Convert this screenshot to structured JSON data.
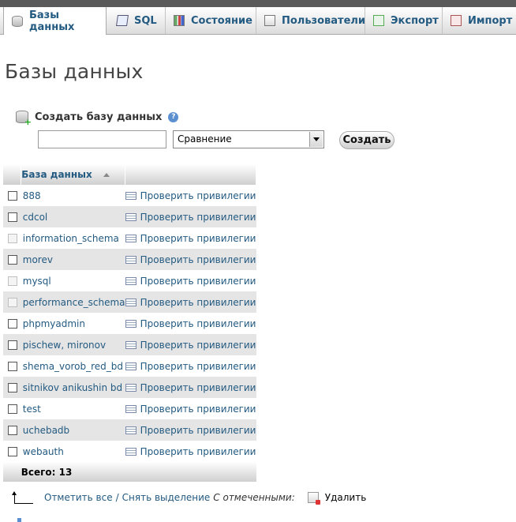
{
  "tabs": [
    {
      "label": "Базы данных",
      "icon": "database-icon",
      "active": true
    },
    {
      "label": "SQL",
      "icon": "sql-icon"
    },
    {
      "label": "Состояние",
      "icon": "status-icon"
    },
    {
      "label": "Пользователи",
      "icon": "users-icon"
    },
    {
      "label": "Экспорт",
      "icon": "export-icon"
    },
    {
      "label": "Импорт",
      "icon": "import-icon"
    }
  ],
  "page_title": "Базы данных",
  "create": {
    "label": "Создать базу данных",
    "collation": "Сравнение",
    "button": "Создать"
  },
  "table": {
    "header": "База данных",
    "rows": [
      {
        "name": "888",
        "action": "Проверить привилегии",
        "system": false
      },
      {
        "name": "cdcol",
        "action": "Проверить привилегии",
        "system": false
      },
      {
        "name": "information_schema",
        "action": "Проверить привилегии",
        "system": true
      },
      {
        "name": "morev",
        "action": "Проверить привилегии",
        "system": false
      },
      {
        "name": "mysql",
        "action": "Проверить привилегии",
        "system": true
      },
      {
        "name": "performance_schema",
        "action": "Проверить привилегии",
        "system": true
      },
      {
        "name": "phpmyadmin",
        "action": "Проверить привилегии",
        "system": false
      },
      {
        "name": "pischew, mironov",
        "action": "Проверить привилегии",
        "system": false
      },
      {
        "name": "shema_vorob_red_bd",
        "action": "Проверить привилегии",
        "system": false
      },
      {
        "name": "sitnikov anikushin bd",
        "action": "Проверить привилегии",
        "system": false
      },
      {
        "name": "test",
        "action": "Проверить привилегии",
        "system": false
      },
      {
        "name": "uchebadb",
        "action": "Проверить привилегии",
        "system": false
      },
      {
        "name": "webauth",
        "action": "Проверить привилегии",
        "system": false
      }
    ],
    "total": "Всего: 13"
  },
  "footer": {
    "check_all": "Отметить все",
    "separator": "/",
    "uncheck_all": "Снять выделение",
    "with_selected": "С отмеченными:",
    "delete": "Удалить"
  },
  "colors": {
    "link": "#235a81",
    "row_alt": "#e5e5e5"
  }
}
